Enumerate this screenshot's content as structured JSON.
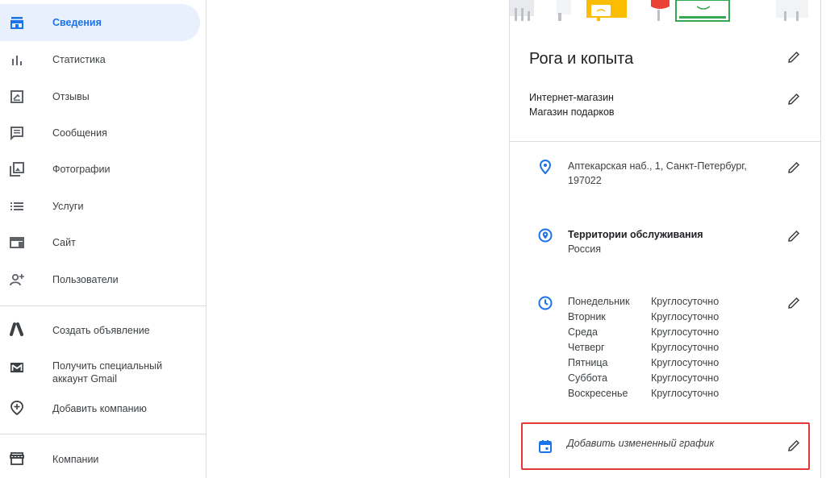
{
  "sidebar": {
    "items": [
      {
        "label": "Сведения",
        "icon": "storefront-icon",
        "active": true
      },
      {
        "label": "Статистика",
        "icon": "bar-chart-icon"
      },
      {
        "label": "Отзывы",
        "icon": "reviews-icon"
      },
      {
        "label": "Сообщения",
        "icon": "message-icon"
      },
      {
        "label": "Фотографии",
        "icon": "photo-library-icon"
      },
      {
        "label": "Услуги",
        "icon": "list-icon"
      },
      {
        "label": "Сайт",
        "icon": "website-icon"
      },
      {
        "label": "Пользователи",
        "icon": "add-user-icon"
      }
    ],
    "secondary": [
      {
        "label": "Создать объявление",
        "icon": "google-ads-icon"
      },
      {
        "label": "Получить специальный аккаунт Gmail",
        "icon": "gmail-icon"
      },
      {
        "label": "Добавить компанию",
        "icon": "add-location-icon"
      }
    ],
    "bottom": [
      {
        "label": "Компании",
        "icon": "businesses-icon"
      }
    ]
  },
  "business": {
    "name": "Рога и копыта",
    "categories": [
      "Интернет-магазин",
      "Магазин подарков"
    ],
    "address": "Аптекарская наб., 1, Санкт-Петербург, 197022",
    "service_area_title": "Территории обслуживания",
    "service_area_value": "Россия",
    "hours": [
      {
        "day": "Понедельник",
        "time": "Круглосуточно"
      },
      {
        "day": "Вторник",
        "time": "Круглосуточно"
      },
      {
        "day": "Среда",
        "time": "Круглосуточно"
      },
      {
        "day": "Четверг",
        "time": "Круглосуточно"
      },
      {
        "day": "Пятница",
        "time": "Круглосуточно"
      },
      {
        "day": "Суббота",
        "time": "Круглосуточно"
      },
      {
        "day": "Воскресенье",
        "time": "Круглосуточно"
      }
    ],
    "special_hours_label": "Добавить измененный график"
  },
  "colors": {
    "accent": "#1a73e8",
    "active_bg": "#e8f0fe",
    "highlight_border": "#e53935",
    "icon_gray": "#5f6368"
  }
}
